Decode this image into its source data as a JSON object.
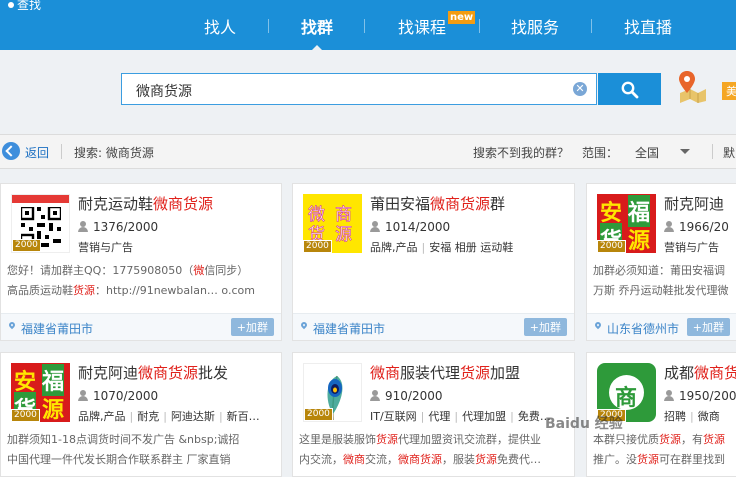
{
  "header": {
    "brand": "查找",
    "nav": [
      {
        "label": "找人"
      },
      {
        "label": "找群"
      },
      {
        "label": "找课程",
        "badge": "new"
      },
      {
        "label": "找服务"
      },
      {
        "label": "找直播"
      }
    ]
  },
  "search": {
    "value": "微商货源",
    "location_badge": "美"
  },
  "filter": {
    "back": "返回",
    "search_term": "搜索: 微商货源",
    "not_found": "搜索不到我的群？",
    "range_label": "范围：",
    "range_value": "全国",
    "sort_label": "默"
  },
  "cards": [
    {
      "title_parts": [
        "耐克运动鞋",
        "微商货源"
      ],
      "members": "1376/2000",
      "tags": [
        "营销与广告"
      ],
      "capacity": "2000",
      "desc1_parts": [
        "您好！请加群主QQ：1775908050（",
        "微",
        "信同步）"
      ],
      "desc2_parts": [
        "高品质运动鞋",
        "货源",
        "：http://91newbalan…  o.com"
      ],
      "region": "福建省莆田市",
      "join": "+加群"
    },
    {
      "title_parts": [
        "莆田安福",
        "微商货源",
        "群"
      ],
      "members": "1014/2000",
      "tags": [
        "品牌,产品",
        "安福 相册 运动鞋"
      ],
      "capacity": "2000",
      "region": "福建省莆田市",
      "join": "+加群"
    },
    {
      "title_parts": [
        "耐克阿迪"
      ],
      "members": "1966/20",
      "tags": [
        "营销与广告"
      ],
      "capacity": "2000",
      "desc1": "加群必须知道：莆田安福调",
      "desc2": "万斯 乔丹运动鞋批发代理微",
      "region": "山东省德州市",
      "join": "+加群"
    },
    {
      "title_parts": [
        "耐克阿迪",
        "微商货源",
        "批发"
      ],
      "members": "1070/2000",
      "tags": [
        "品牌,产品",
        "耐克",
        "阿迪达斯",
        "新百…"
      ],
      "capacity": "2000",
      "desc1": "加群须知1-18点调货时间不发广告 &nbsp;诚招",
      "desc2": "中国代理一件代发长期合作联系群主 厂家直销"
    },
    {
      "title_parts": [
        "微商",
        "服装代理",
        "货源",
        "加盟"
      ],
      "members": "910/2000",
      "tags": [
        "IT/互联网",
        "代理",
        "代理加盟",
        "免费…"
      ],
      "capacity": "2000",
      "desc1_parts": [
        "这里是服装服饰",
        "货源",
        "代理加盟资讯交流群，提供业"
      ],
      "desc2_parts": [
        "内交流，",
        "微商",
        "交流，",
        "微商货源",
        "，服装",
        "货源",
        "免费代…"
      ]
    },
    {
      "title_parts": [
        "成都",
        "微商货"
      ],
      "members": "1950/200",
      "tags": [
        "招聘",
        "微商"
      ],
      "capacity": "2000",
      "desc1_parts": [
        "本群只接优质",
        "货源",
        "，有",
        "货源"
      ],
      "desc2_parts": [
        "推广。没",
        "货源",
        "可在群里找到"
      ]
    }
  ],
  "thumb_text": {
    "card2": [
      "微",
      "商",
      "货",
      "源"
    ],
    "card3": [
      "安",
      "福",
      "货",
      "源"
    ],
    "card6": "商"
  },
  "watermark": "Baidu 经验",
  "colors": {
    "primary": "#1b8fd8",
    "highlight": "#e0211b",
    "region": "#3b84c8"
  }
}
